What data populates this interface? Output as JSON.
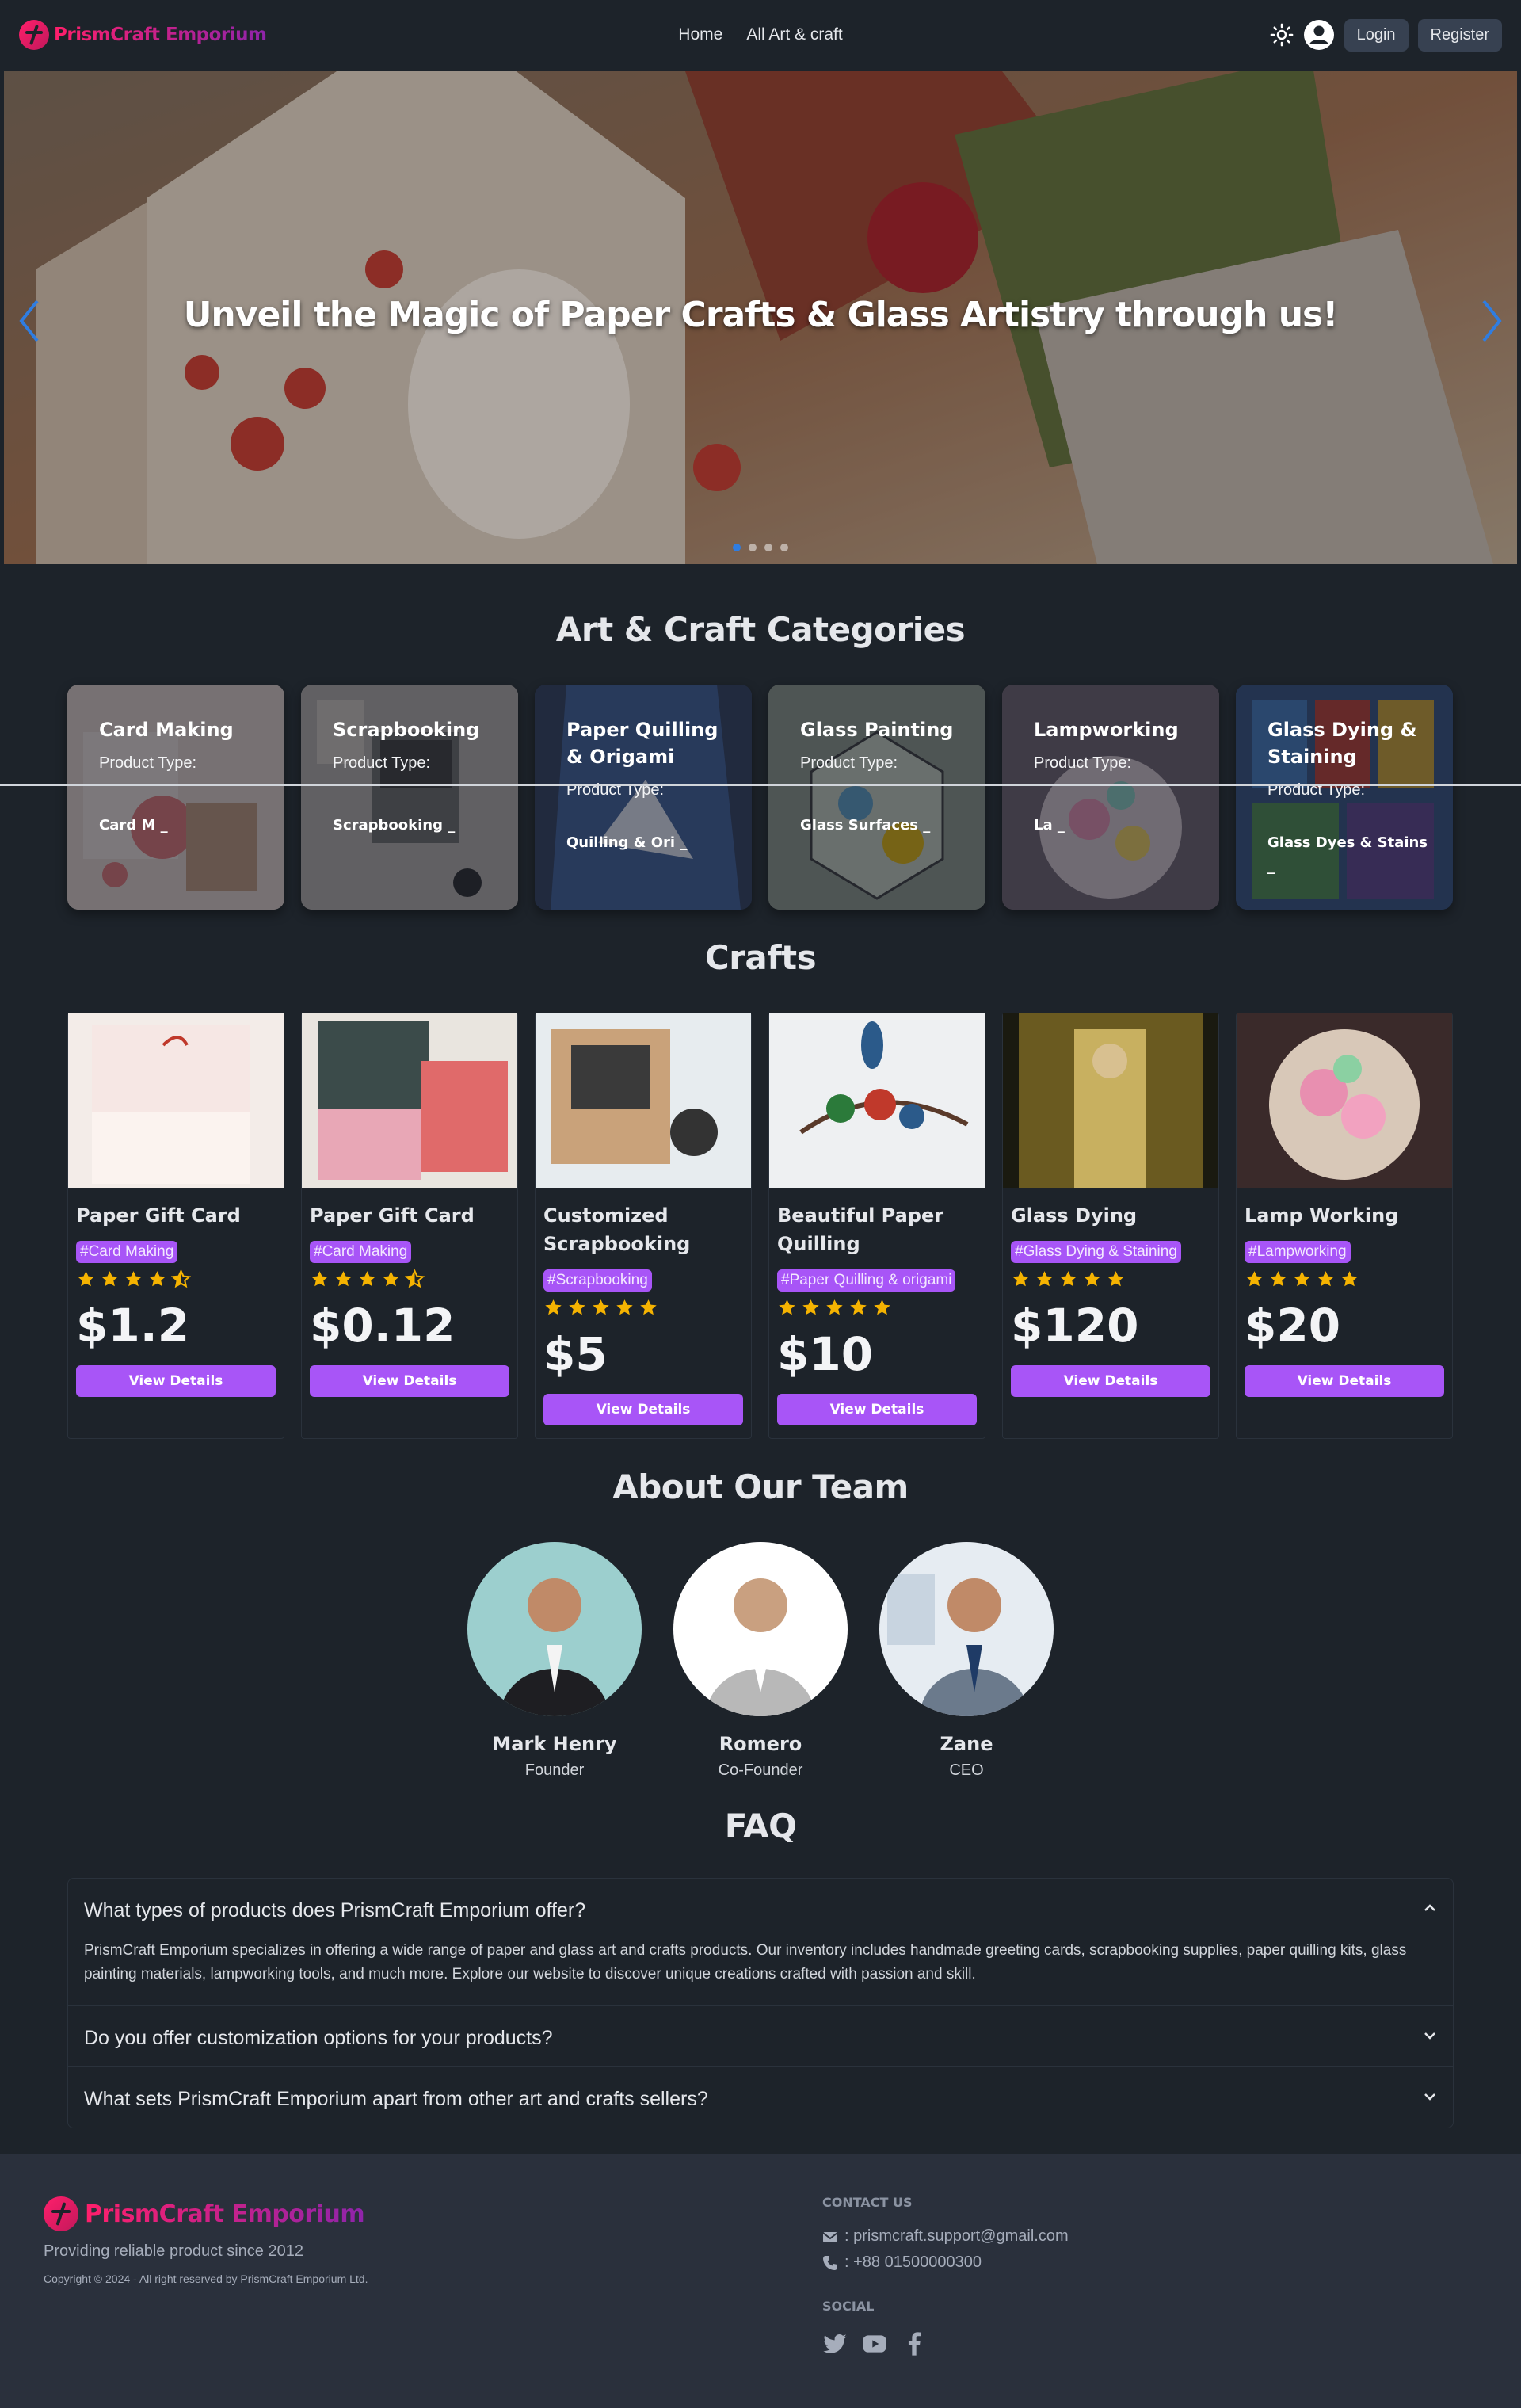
{
  "brand": {
    "name": "PrismCraft Emporium",
    "accent": "#a855f7",
    "logo_gradient": [
      "#ff1f6b",
      "#8e24aa"
    ]
  },
  "nav": {
    "links": [
      "Home",
      "All Art & craft"
    ],
    "login_label": "Login",
    "register_label": "Register",
    "theme_icon": "sun-icon",
    "user_icon": "user-avatar-icon"
  },
  "hero": {
    "title": "Unveil the Magic of Paper Crafts & Glass Artistry through us!",
    "slides": 4,
    "active_slide": 1
  },
  "categories": {
    "title": "Art & Craft Categories",
    "type_label": "Product Type:",
    "items": [
      {
        "name": "Card Making",
        "subcategory": "Card M _"
      },
      {
        "name": "Scrapbooking",
        "subcategory": "Scrapbooking _"
      },
      {
        "name": "Paper Quilling & Origami",
        "subcategory": "Quilling & Ori _"
      },
      {
        "name": "Glass Painting",
        "subcategory": "Glass Surfaces _"
      },
      {
        "name": "Lampworking",
        "subcategory": "La _"
      },
      {
        "name": "Glass Dying & Staining",
        "subcategory": "Glass Dyes & Stains _"
      }
    ]
  },
  "crafts": {
    "title": "Crafts",
    "view_label": "View Details",
    "items": [
      {
        "name": "Paper Gift Card",
        "tag": "#Card Making",
        "rating": 4.5,
        "price": "$1.2"
      },
      {
        "name": "Paper Gift Card",
        "tag": "#Card Making",
        "rating": 4.5,
        "price": "$0.12"
      },
      {
        "name": "Customized Scrapbooking",
        "tag": "#Scrapbooking",
        "rating": 5,
        "price": "$5"
      },
      {
        "name": "Beautiful Paper Quilling",
        "tag": "#Paper Quilling & origami",
        "rating": 5,
        "price": "$10"
      },
      {
        "name": "Glass Dying",
        "tag": "#Glass Dying & Staining",
        "rating": 5,
        "price": "$120"
      },
      {
        "name": "Lamp Working",
        "tag": "#Lampworking",
        "rating": 5,
        "price": "$20"
      }
    ]
  },
  "team": {
    "title": "About Our Team",
    "members": [
      {
        "name": "Mark Henry",
        "role": "Founder"
      },
      {
        "name": "Romero",
        "role": "Co-Founder"
      },
      {
        "name": "Zane",
        "role": "CEO"
      }
    ]
  },
  "faq": {
    "title": "FAQ",
    "items": [
      {
        "question": "What types of products does PrismCraft Emporium offer?",
        "answer": "PrismCraft Emporium specializes in offering a wide range of paper and glass art and crafts products. Our inventory includes handmade greeting cards, scrapbooking supplies, paper quilling kits, glass painting materials, lampworking tools, and much more. Explore our website to discover unique creations crafted with passion and skill.",
        "open": true
      },
      {
        "question": "Do you offer customization options for your products?",
        "open": false
      },
      {
        "question": "What sets PrismCraft Emporium apart from other art and crafts sellers?",
        "open": false
      }
    ]
  },
  "footer": {
    "tagline": "Providing reliable product since 2012",
    "copyright": "Copyright © 2024 - All right reserved by PrismCraft Emporium Ltd.",
    "contact_heading": "CONTACT US",
    "email": ": prismcraft.support@gmail.com",
    "phone": ": +88 01500000300",
    "social_heading": "SOCIAL",
    "social_icons": [
      "twitter-icon",
      "youtube-icon",
      "facebook-icon"
    ]
  }
}
